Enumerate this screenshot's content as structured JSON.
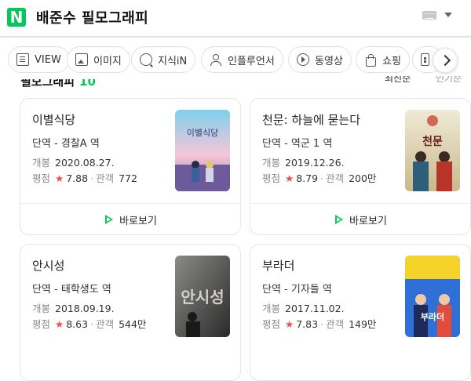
{
  "header": {
    "logo": "N",
    "query": "배준수 필모그래피",
    "icons": [
      "keyboard-icon",
      "caret-down-icon"
    ]
  },
  "tabs": [
    {
      "label": "VIEW",
      "icon": "view-icon"
    },
    {
      "label": "이미지",
      "icon": "image-icon"
    },
    {
      "label": "지식iN",
      "icon": "kin-icon"
    },
    {
      "label": "인플루언서",
      "icon": "influencer-icon"
    },
    {
      "label": "동영상",
      "icon": "video-icon"
    },
    {
      "label": "쇼핑",
      "icon": "shopping-icon"
    },
    {
      "label": "",
      "icon": "more-tab-icon"
    }
  ],
  "section": {
    "title": "필모그래피",
    "count": "10",
    "sort": [
      "최신순",
      "인기순"
    ]
  },
  "colors": {
    "brand": "#03c75a",
    "star": "#f54b4b"
  },
  "movies": [
    {
      "title": "이별식당",
      "role": "단역 - 경찰A 역",
      "release_label": "개봉",
      "release_date": "2020.08.27.",
      "rating_label": "평점",
      "rating": "7.88",
      "audience_label": "관객",
      "audience": "772",
      "watch_label": "바로보기",
      "poster_text": "이별식당"
    },
    {
      "title": "천문: 하늘에 묻는다",
      "role": "단역 - 역군 1 역",
      "release_label": "개봉",
      "release_date": "2019.12.26.",
      "rating_label": "평점",
      "rating": "8.79",
      "audience_label": "관객",
      "audience": "200만",
      "watch_label": "바로보기",
      "poster_text": "천문"
    },
    {
      "title": "안시성",
      "role": "단역 - 태학생도 역",
      "release_label": "개봉",
      "release_date": "2018.09.19.",
      "rating_label": "평점",
      "rating": "8.63",
      "audience_label": "관객",
      "audience": "544만",
      "watch_label": "바로보기",
      "poster_text": "안시성"
    },
    {
      "title": "부라더",
      "role": "단역 - 기자들 역",
      "release_label": "개봉",
      "release_date": "2017.11.02.",
      "rating_label": "평점",
      "rating": "7.83",
      "audience_label": "관객",
      "audience": "149만",
      "watch_label": "바로보기",
      "poster_text": "부라더"
    }
  ]
}
